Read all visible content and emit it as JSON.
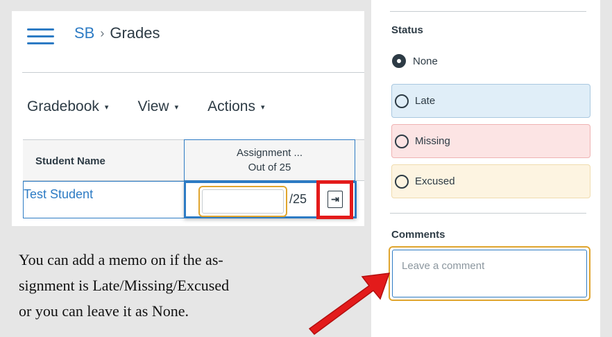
{
  "header": {
    "breadcrumb_link": "SB",
    "breadcrumb_sep": "›",
    "breadcrumb_current": "Grades"
  },
  "toolbar": {
    "gradebook_label": "Gradebook",
    "view_label": "View",
    "actions_label": "Actions",
    "caret": "▾"
  },
  "grid": {
    "student_header": "Student Name",
    "assignment_header_line1": "Assignment ...",
    "assignment_header_line2": "Out of 25",
    "rows": [
      {
        "student": "Test Student",
        "grade_value": "",
        "grade_total": "/25"
      }
    ],
    "expand_icon": "⇥"
  },
  "status_panel": {
    "title": "Status",
    "options": [
      {
        "label": "None",
        "checked": true
      },
      {
        "label": "Late",
        "checked": false
      },
      {
        "label": "Missing",
        "checked": false
      },
      {
        "label": "Excused",
        "checked": false
      }
    ],
    "comments_label": "Comments",
    "comment_placeholder": "Leave a comment"
  },
  "caption": {
    "line1": "You can add a memo on if the as-",
    "line2": "signment is Late/Missing/Excused",
    "line3": "or you can leave it as None."
  },
  "colors": {
    "link_blue": "#2d7bc4",
    "highlight_red": "#e31b1b",
    "focus_orange": "#e0a52e",
    "late_bg": "#e0eef8",
    "missing_bg": "#fce4e4",
    "excused_bg": "#fdf4e1"
  }
}
